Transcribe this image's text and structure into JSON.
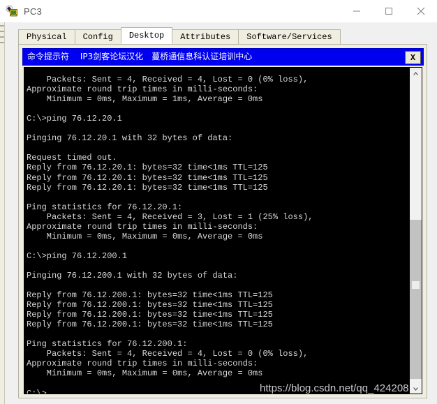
{
  "window": {
    "title": "PC3",
    "icon": "pc-device-icon",
    "controls": {
      "minimize": "—",
      "maximize": "□",
      "close": "✕"
    }
  },
  "tabs": [
    {
      "label": "Physical",
      "active": false
    },
    {
      "label": "Config",
      "active": false
    },
    {
      "label": "Desktop",
      "active": true
    },
    {
      "label": "Attributes",
      "active": false
    },
    {
      "label": "Software/Services",
      "active": false
    }
  ],
  "cmd": {
    "title": "命令提示符　 IP3剑客论坛汉化　蔓桥通信息科认证培训中心",
    "close_label": "X",
    "console_lines": [
      "",
      "    Packets: Sent = 4, Received = 4, Lost = 0 (0% loss),",
      "Approximate round trip times in milli-seconds:",
      "    Minimum = 0ms, Maximum = 1ms, Average = 0ms",
      "",
      "C:\\>ping 76.12.20.1",
      "",
      "Pinging 76.12.20.1 with 32 bytes of data:",
      "",
      "Request timed out.",
      "Reply from 76.12.20.1: bytes=32 time<1ms TTL=125",
      "Reply from 76.12.20.1: bytes=32 time<1ms TTL=125",
      "Reply from 76.12.20.1: bytes=32 time<1ms TTL=125",
      "",
      "Ping statistics for 76.12.20.1:",
      "    Packets: Sent = 4, Received = 3, Lost = 1 (25% loss),",
      "Approximate round trip times in milli-seconds:",
      "    Minimum = 0ms, Maximum = 0ms, Average = 0ms",
      "",
      "C:\\>ping 76.12.200.1",
      "",
      "Pinging 76.12.200.1 with 32 bytes of data:",
      "",
      "Reply from 76.12.200.1: bytes=32 time<1ms TTL=125",
      "Reply from 76.12.200.1: bytes=32 time<1ms TTL=125",
      "Reply from 76.12.200.1: bytes=32 time<1ms TTL=125",
      "Reply from 76.12.200.1: bytes=32 time<1ms TTL=125",
      "",
      "Ping statistics for 76.12.200.1:",
      "    Packets: Sent = 4, Received = 4, Lost = 0 (0% loss),",
      "Approximate round trip times in milli-seconds:",
      "    Minimum = 0ms, Maximum = 0ms, Average = 0ms",
      "",
      "C:\\>"
    ]
  },
  "scrollbar": {
    "up_arrow": "∧",
    "down_arrow": "∨"
  },
  "watermark": {
    "text": "https://blog.csdn.net/qq_424208"
  },
  "colors": {
    "cmd_titlebar": "#0000ee",
    "console_bg": "#000000",
    "console_fg": "#d8d8d8",
    "panel_bg": "#f0eee0",
    "tab_active_bg": "#ffffff"
  }
}
